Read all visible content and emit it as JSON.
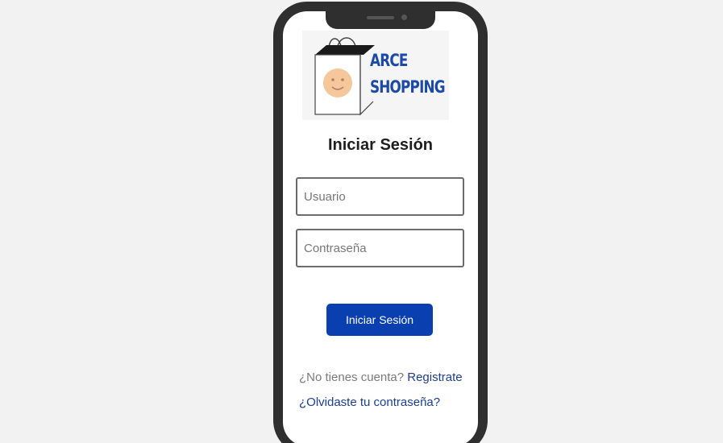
{
  "brand": {
    "line1": "ARCE",
    "line2": "SHOPPING",
    "color": "#1d4aa6"
  },
  "login": {
    "title": "Iniciar Sesión",
    "username_placeholder": "Usuario",
    "password_placeholder": "Contraseña",
    "submit_label": "Iniciar Sesión"
  },
  "footer": {
    "no_account_text": "¿No tienes cuenta?",
    "register_link": "Registrate",
    "forgot_link": "¿Olvidaste tu contraseña?"
  },
  "colors": {
    "button": "#0a3fb0",
    "link": "#1d3f8f",
    "phone_frame": "#2f2f2f"
  },
  "icons": [
    "shopping-bag-icon",
    "smiley-icon"
  ]
}
